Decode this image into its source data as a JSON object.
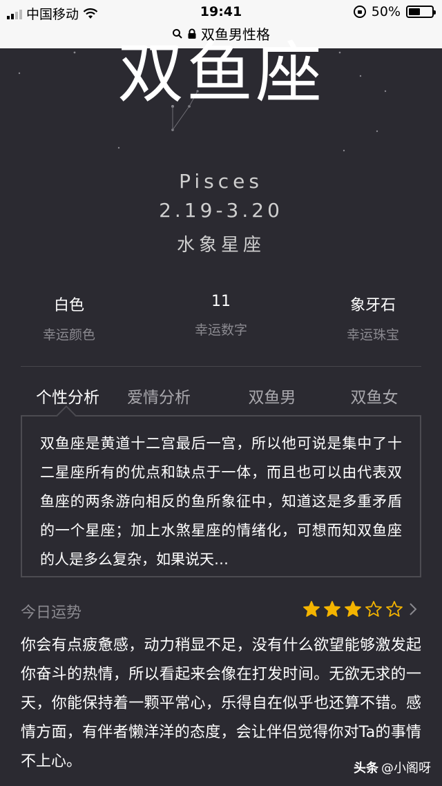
{
  "status_bar": {
    "carrier": "中国移动",
    "time": "19:41",
    "battery": "50%",
    "page_title": "双鱼男性格"
  },
  "hero": {
    "title": "双鱼座",
    "english_name": "Pisces",
    "dates": "2.19-3.20",
    "element": "水象星座"
  },
  "lucky": [
    {
      "value": "白色",
      "label": "幸运颜色"
    },
    {
      "value": "11",
      "label": "幸运数字"
    },
    {
      "value": "象牙石",
      "label": "幸运珠宝"
    }
  ],
  "tabs": [
    {
      "label": "个性分析",
      "active": true
    },
    {
      "label": "爱情分析",
      "active": false
    },
    {
      "label": "双鱼男",
      "active": false
    },
    {
      "label": "双鱼女",
      "active": false
    }
  ],
  "description": "双鱼座是黄道十二宫最后一宫，所以他可说是集中了十二星座所有的优点和缺点于一体，而且也可以由代表双鱼座的两条游向相反的鱼所象征中，知道这是多重矛盾的一个星座；加上水煞星座的情绪化，可想而知双鱼座的人是多么复杂，如果说天…",
  "fortune": {
    "title": "今日运势",
    "rating": 3,
    "rating_max": 5,
    "text": "你会有点疲惫感，动力稍显不足，没有什么欲望能够激发起你奋斗的热情，所以看起来会像在打发时间。无欲无求的一天，你能保持着一颗平常心，乐得自在似乎也还算不错。感情方面，有伴者懒洋洋的态度，会让伴侣觉得你对Ta的事情不上心。"
  },
  "watermark": {
    "brand": "头条",
    "handle": "@小阁呀"
  },
  "colors": {
    "background": "#2b2a31",
    "star_gold": "#f4b400"
  }
}
